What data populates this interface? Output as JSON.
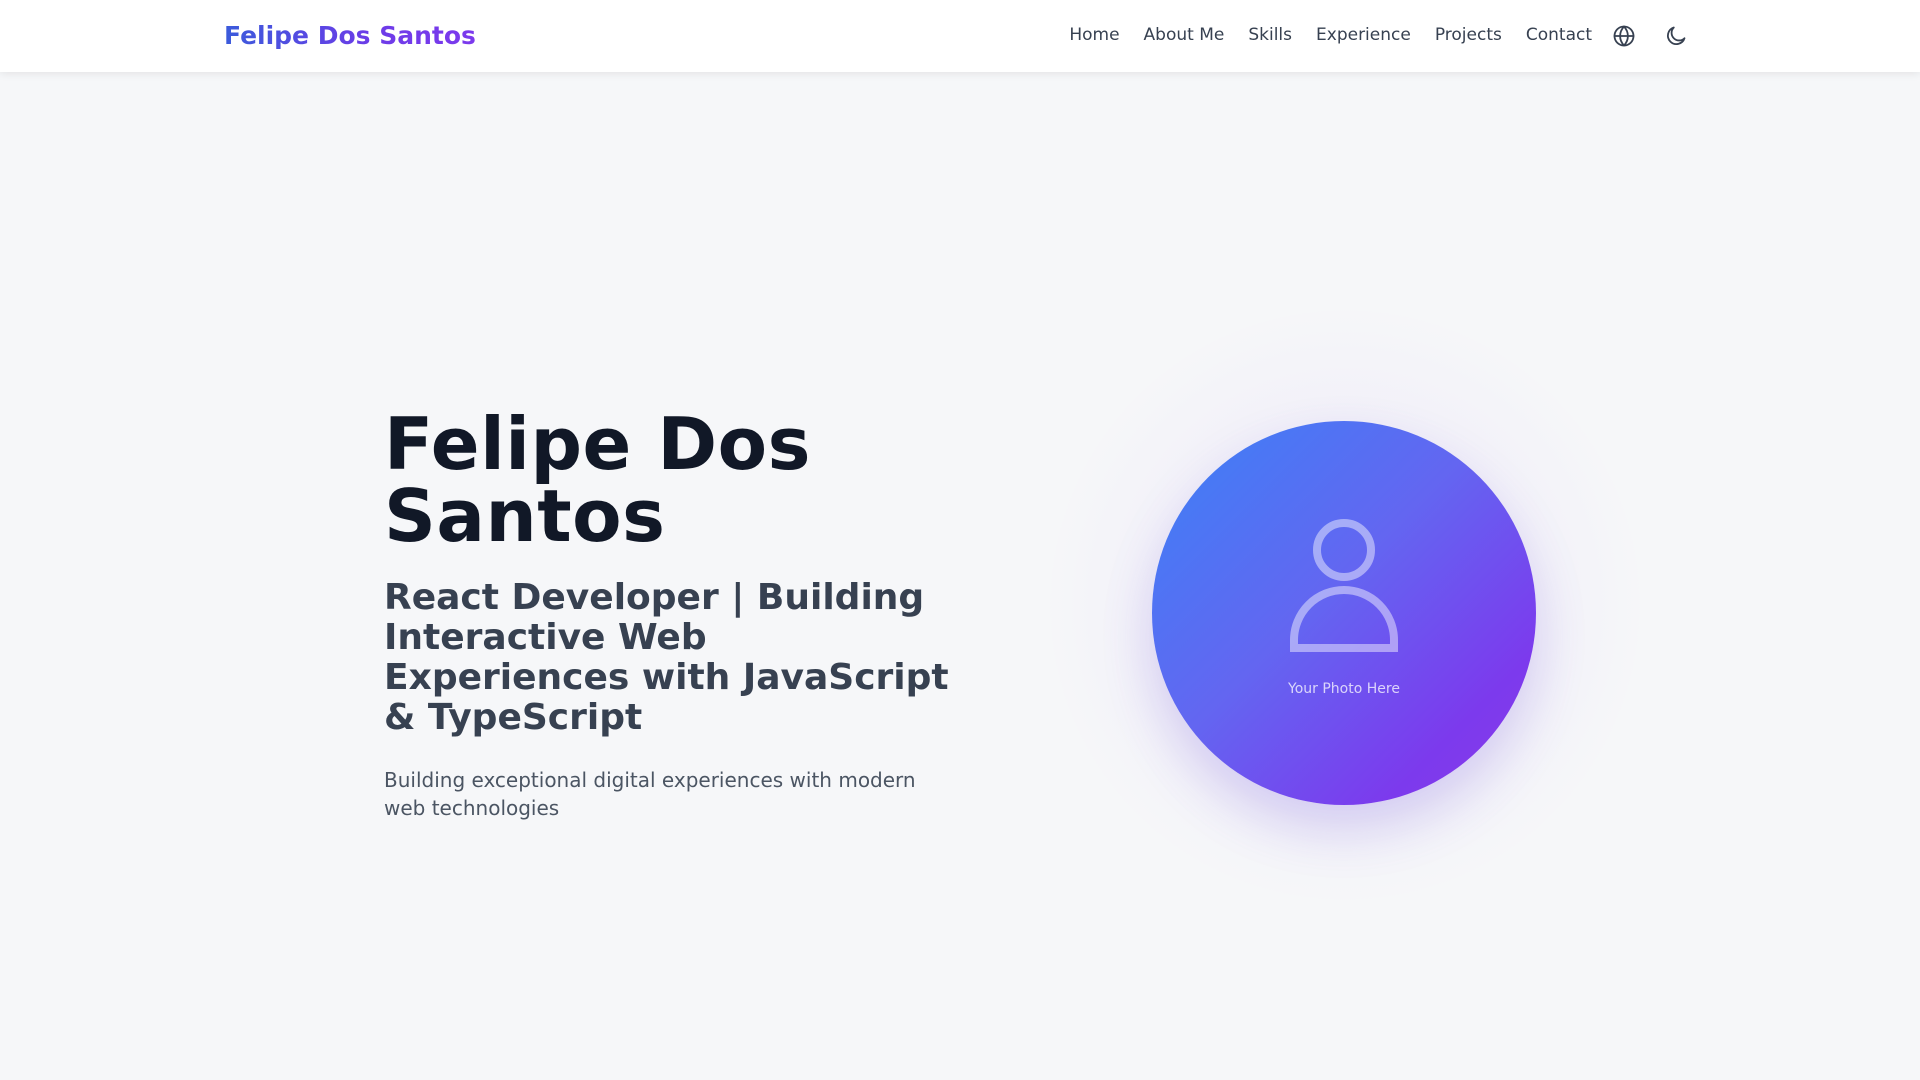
{
  "header": {
    "brand": "Felipe Dos Santos",
    "nav": [
      {
        "label": "Home"
      },
      {
        "label": "About Me"
      },
      {
        "label": "Skills"
      },
      {
        "label": "Experience"
      },
      {
        "label": "Projects"
      },
      {
        "label": "Contact"
      }
    ],
    "icons": {
      "language": "globe-icon",
      "theme": "moon-icon"
    }
  },
  "hero": {
    "name": "Felipe Dos Santos",
    "role": "React Developer | Building Interactive Web Experiences with JavaScript & TypeScript",
    "tagline": "Building exceptional digital experiences with modern web technologies",
    "photo_placeholder": "Your Photo Here",
    "photo_icon": "user-icon"
  },
  "colors": {
    "brand_gradient_start": "#3b5bdb",
    "brand_gradient_end": "#7c3aed",
    "photo_gradient_start": "#3b82f6",
    "photo_gradient_end": "#8b3ce9",
    "background": "#f6f7f9",
    "heading": "#111827",
    "subheading": "#374151"
  }
}
